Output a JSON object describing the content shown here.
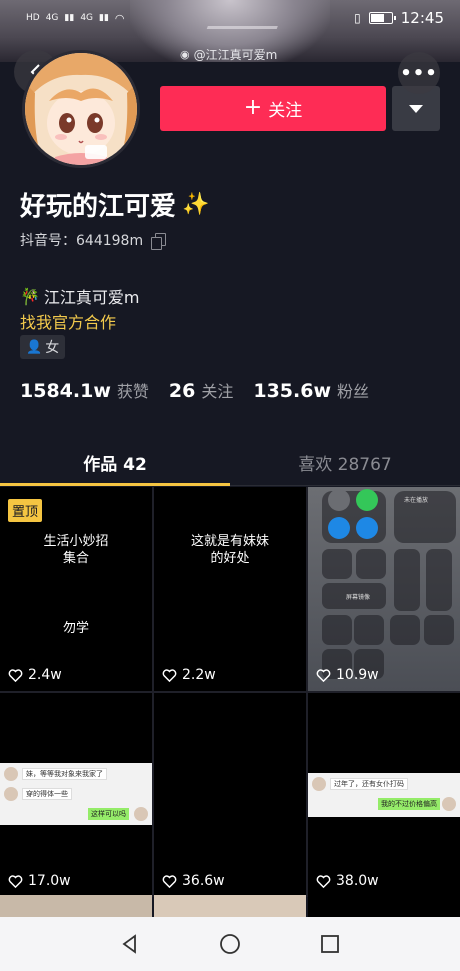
{
  "status": {
    "carrier_left": "HD",
    "signal1": "4G",
    "signal2": "4G",
    "time": "12:45"
  },
  "watermark": "@江江真可爱m",
  "profile": {
    "nickname": "好玩的江可爱",
    "nickname_emoji": "✨",
    "douyin_id": "抖音号：644198m",
    "bio_line1": "江江真可爱m",
    "bio_line2": "找我官方合作",
    "gender": "女"
  },
  "actions": {
    "follow_label": "关注",
    "follow_icon": "plus-icon"
  },
  "stats": [
    {
      "num": "1584.1w",
      "label": "获赞"
    },
    {
      "num": "26",
      "label": "关注"
    },
    {
      "num": "135.6w",
      "label": "粉丝"
    }
  ],
  "tabs": [
    {
      "label": "作品 42",
      "active": true
    },
    {
      "label": "喜欢 28767",
      "active": false
    }
  ],
  "videos": [
    {
      "pinned": "置顶",
      "title_lines": [
        "生活小妙招",
        "集合"
      ],
      "subtitle": "勿学",
      "likes": "2.4w"
    },
    {
      "title_lines": [
        "这就是有妹妹",
        "的好处"
      ],
      "likes": "2.2w"
    },
    {
      "likes": "10.9w",
      "cc_texts": [
        "未在播放",
        "屏幕镜像"
      ]
    },
    {
      "likes": "17.0w",
      "chat": [
        "妹，等等我对象来我家了",
        "穿的得体一些",
        "这样可以吗"
      ]
    },
    {
      "likes": "36.6w"
    },
    {
      "likes": "38.0w",
      "chat": [
        "过年了，还有女仆打码",
        "我的不过价格偏高"
      ]
    }
  ],
  "colors": {
    "background": "#161823",
    "follow": "#fe2c55",
    "accent_yellow": "#f5c542"
  }
}
